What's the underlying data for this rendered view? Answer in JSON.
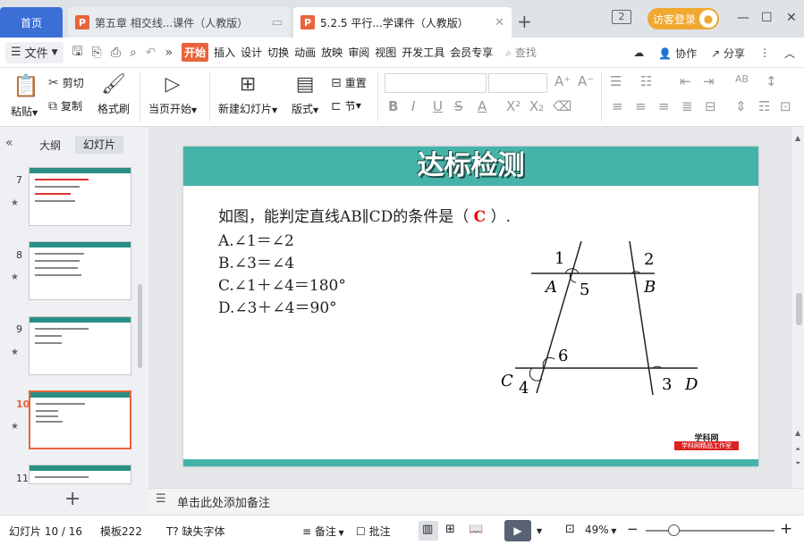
{
  "tabs": {
    "home": "首页",
    "tab1": "第五章 相交线...课件（人教版）",
    "tab2": "5.2.5 平行...学课件（人教版）",
    "window_count": "2",
    "login": "访客登录"
  },
  "menu": {
    "file": "文件",
    "items": [
      "开始",
      "插入",
      "设计",
      "切换",
      "动画",
      "放映",
      "审阅",
      "视图",
      "开发工具",
      "会员专享"
    ],
    "search": "查找",
    "collab": "协作",
    "share": "分享"
  },
  "ribbon": {
    "paste": "粘贴",
    "cut": "剪切",
    "copy": "复制",
    "format_painter": "格式刷",
    "from_current": "当页开始",
    "new_slide": "新建幻灯片",
    "layout": "版式",
    "reset": "重置",
    "section": "节"
  },
  "panel": {
    "outline": "大纲",
    "slides": "幻灯片",
    "thumbs": [
      "7",
      "8",
      "9",
      "10",
      "11"
    ]
  },
  "slide": {
    "title": "达标检测",
    "question_pre": "如图，能判定直线AB∥CD的条件是（",
    "answer": "C",
    "question_post": "）.",
    "options": [
      "A.∠1＝∠2",
      "B.∠3＝∠4",
      "C.∠1＋∠4＝180°",
      "D.∠3＋∠4＝90°"
    ],
    "labels": {
      "n1": "1",
      "n2": "2",
      "n3": "3",
      "n4": "4",
      "n5": "5",
      "n6": "6",
      "A": "A",
      "B": "B",
      "C": "C",
      "D": "D"
    },
    "logo_top": "学科网",
    "logo_bottom": "学科网精品工作室"
  },
  "notes": "单击此处添加备注",
  "status": {
    "slide_info": "幻灯片 10 / 16",
    "template": "模板222",
    "missing_font": "缺失字体",
    "notes": "备注",
    "comments": "批注",
    "zoom": "49%"
  },
  "colors": {
    "accent": "#e8643c",
    "teal": "#45b3a8",
    "tab_blue": "#3b6fd6",
    "login": "#f0a830"
  }
}
